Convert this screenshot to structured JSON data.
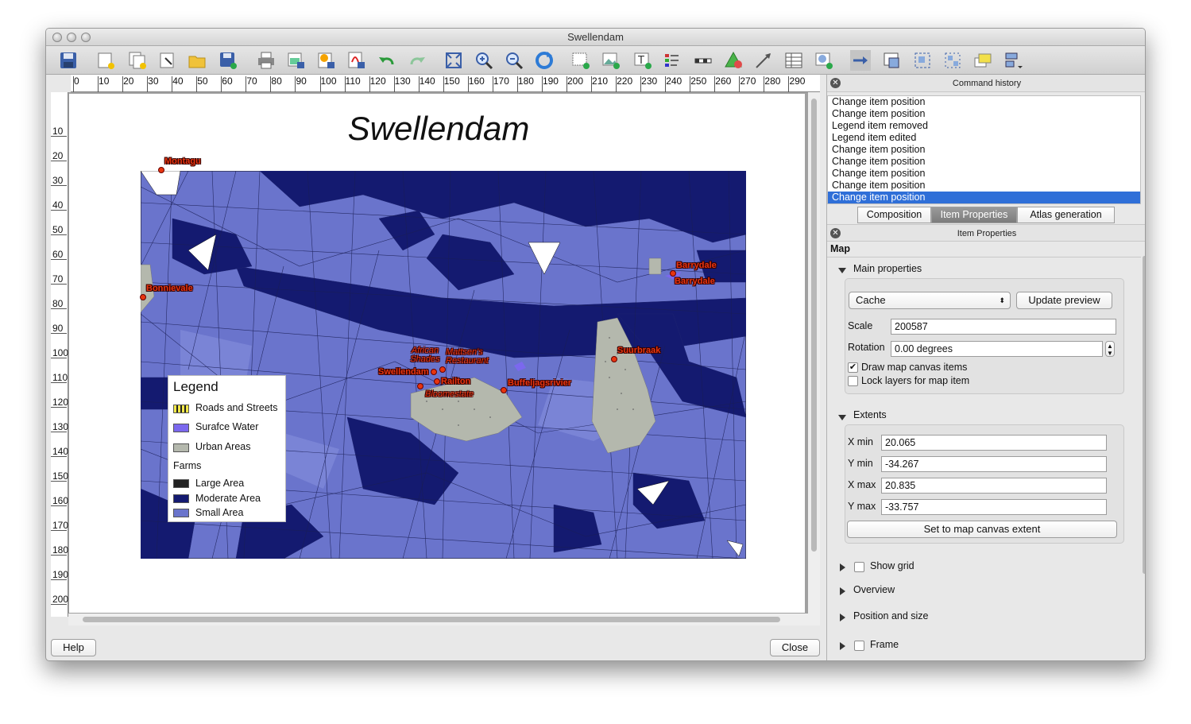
{
  "window": {
    "title": "Swellendam"
  },
  "toolbar": {
    "icons": [
      "save-icon",
      "new-composer-icon",
      "duplicate-composer-icon",
      "composer-manager-icon",
      "open-template-icon",
      "save-template-icon",
      "print-icon",
      "export-image-icon",
      "export-svg-icon",
      "export-pdf-icon",
      "undo-icon",
      "redo-icon",
      "zoom-full-icon",
      "zoom-in-icon",
      "zoom-out-icon",
      "refresh-icon",
      "add-map-icon",
      "add-image-icon",
      "add-label-icon",
      "add-legend-icon",
      "add-scalebar-icon",
      "add-shape-icon",
      "add-arrow-icon",
      "add-table-icon",
      "add-html-icon",
      "select-move-icon",
      "move-content-icon",
      "group-icon",
      "ungroup-icon",
      "raise-icon",
      "align-icon"
    ]
  },
  "ruler": {
    "horizontal": [
      "0",
      "10",
      "20",
      "30",
      "40",
      "50",
      "60",
      "70",
      "80",
      "90",
      "100",
      "110",
      "120",
      "130",
      "140",
      "150",
      "160",
      "170",
      "180",
      "190",
      "200",
      "210",
      "220",
      "230",
      "240",
      "250",
      "260",
      "270",
      "280",
      "290"
    ],
    "vertical": [
      "10",
      "20",
      "30",
      "40",
      "50",
      "60",
      "70",
      "80",
      "90",
      "100",
      "110",
      "120",
      "130",
      "140",
      "150",
      "160",
      "170",
      "180",
      "190",
      "200"
    ]
  },
  "composition": {
    "title": "Swellendam",
    "legend": {
      "title": "Legend",
      "items": [
        {
          "label": "Roads and Streets",
          "color": "#f2e84a"
        },
        {
          "label": "Surafce Water",
          "color": "#7b68ee"
        },
        {
          "label": "Urban Areas",
          "color": "#b4b8ad"
        }
      ],
      "group": "Farms",
      "group_items": [
        {
          "label": "Large Area",
          "color": "#222222"
        },
        {
          "label": "Moderate Area",
          "color": "#141a70"
        },
        {
          "label": "Small Area",
          "color": "#6a74cc"
        }
      ]
    },
    "places": [
      "Montagu",
      "Bonnievale",
      "Barrydale",
      "Barrydale",
      "Suurbraak",
      "African Shades",
      "Mattsen's Restaurant",
      "Swellendam",
      "Railton",
      "Bloomestate",
      "Buffeljagsrivier"
    ]
  },
  "footer": {
    "help": "Help",
    "close": "Close"
  },
  "command_history": {
    "title": "Command history",
    "items": [
      "Change item position",
      "Change item position",
      "Legend item removed",
      "Legend item edited",
      "Change item position",
      "Change item position",
      "Change item position",
      "Change item position",
      "Change item position"
    ],
    "selected_index": 8
  },
  "tabs": [
    "Composition",
    "Item Properties",
    "Atlas generation"
  ],
  "active_tab": "Item Properties",
  "item_properties": {
    "title": "Item Properties",
    "type": "Map",
    "main_properties": {
      "header": "Main properties",
      "mode": "Cache",
      "update_preview": "Update preview",
      "scale_label": "Scale",
      "scale": "200587",
      "rotation_label": "Rotation",
      "rotation": "0.00 degrees",
      "draw_canvas_items": "Draw map canvas items",
      "draw_canvas_items_checked": true,
      "lock_layers": "Lock layers for map item",
      "lock_layers_checked": false
    },
    "extents": {
      "header": "Extents",
      "xmin_label": "X min",
      "xmin": "20.065",
      "ymin_label": "Y min",
      "ymin": "-34.267",
      "xmax_label": "X max",
      "xmax": "20.835",
      "ymax_label": "Y max",
      "ymax": "-33.757",
      "set_extent": "Set to map canvas extent"
    },
    "show_grid": "Show grid",
    "overview": "Overview",
    "position_size": "Position and size",
    "frame": "Frame"
  }
}
